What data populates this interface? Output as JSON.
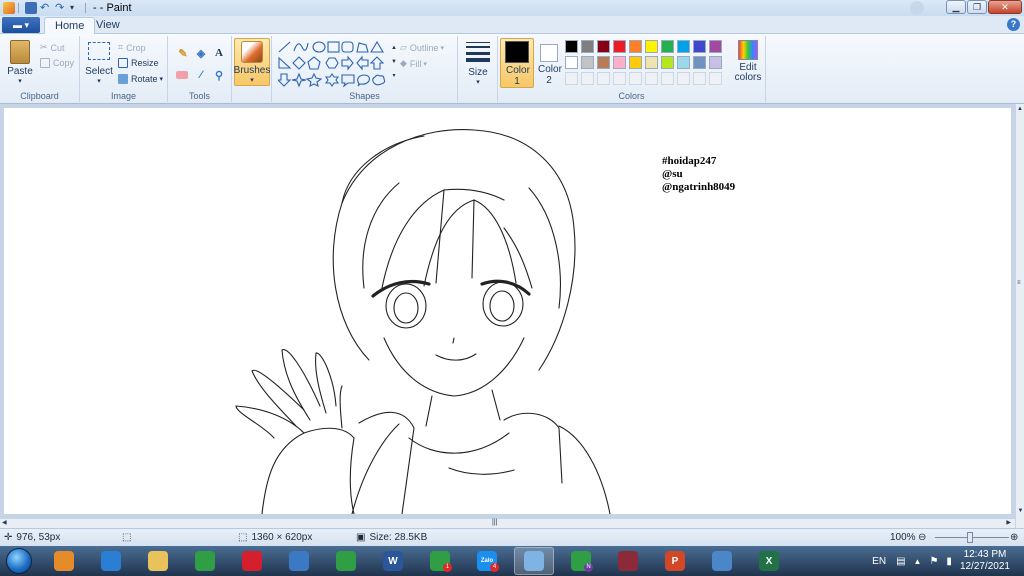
{
  "window": {
    "title": "- - Paint"
  },
  "tabs": [
    {
      "label": "Home",
      "active": true
    },
    {
      "label": "View",
      "active": false
    }
  ],
  "ribbon": {
    "clipboard": {
      "label": "Clipboard",
      "paste": "Paste",
      "cut": "Cut",
      "copy": "Copy"
    },
    "image": {
      "label": "Image",
      "select": "Select",
      "crop": "Crop",
      "resize": "Resize",
      "rotate": "Rotate"
    },
    "tools": {
      "label": "Tools"
    },
    "brushes": {
      "label": "Brushes"
    },
    "shapes": {
      "label": "Shapes",
      "outline": "Outline",
      "fill": "Fill"
    },
    "size": {
      "label": "Size"
    },
    "colors": {
      "label": "Colors",
      "color1": "Color 1",
      "color2": "Color 2",
      "color1_value": "#000000",
      "color2_value": "#ffffff",
      "edit": "Edit colors",
      "palette_row1": [
        "#000000",
        "#7f7f7f",
        "#880015",
        "#ed1c24",
        "#ff7f27",
        "#fff200",
        "#22b14c",
        "#00a2e8",
        "#3f48cc",
        "#a349a4"
      ],
      "palette_row2": [
        "#ffffff",
        "#c3c3c3",
        "#b97a57",
        "#ffaec9",
        "#ffc90e",
        "#efe4b0",
        "#b5e61d",
        "#99d9ea",
        "#7092be",
        "#c8bfe7"
      ]
    }
  },
  "canvas": {
    "text_lines": [
      "#hoidap247",
      "@su",
      "@ngatrinh8049"
    ]
  },
  "status": {
    "cursor": "976, 53px",
    "dimensions": "1360 × 620px",
    "size": "Size: 28.5KB",
    "zoom": "100%"
  },
  "taskbar": {
    "apps": [
      {
        "name": "media-player",
        "color": "#e58b2a"
      },
      {
        "name": "internet-explorer",
        "color": "#2a7fd4"
      },
      {
        "name": "file-explorer",
        "color": "#e8c25a"
      },
      {
        "name": "chrome",
        "color": "#2f9e44"
      },
      {
        "name": "opera",
        "color": "#d61f2c"
      },
      {
        "name": "remote-desktop",
        "color": "#3b79c4"
      },
      {
        "name": "chrome-profile",
        "color": "#2f9e44"
      },
      {
        "name": "word",
        "color": "#2b579a",
        "glyph": "W"
      },
      {
        "name": "chrome-profile-2",
        "color": "#2f9e44",
        "badge": "1"
      },
      {
        "name": "zalo",
        "color": "#1a8ff0",
        "glyph": "Zalo",
        "badge": "4"
      },
      {
        "name": "paint",
        "color": "#7fb3e3"
      },
      {
        "name": "chrome-profile-n",
        "color": "#2f9e44",
        "badge": "N"
      },
      {
        "name": "winrar",
        "color": "#8c2a3a"
      },
      {
        "name": "powerpoint",
        "color": "#d24726",
        "glyph": "P"
      },
      {
        "name": "control-panel",
        "color": "#4a86c8"
      },
      {
        "name": "excel",
        "color": "#217346",
        "glyph": "X"
      }
    ],
    "language": "EN",
    "time": "12:43 PM",
    "date": "12/27/2021"
  }
}
